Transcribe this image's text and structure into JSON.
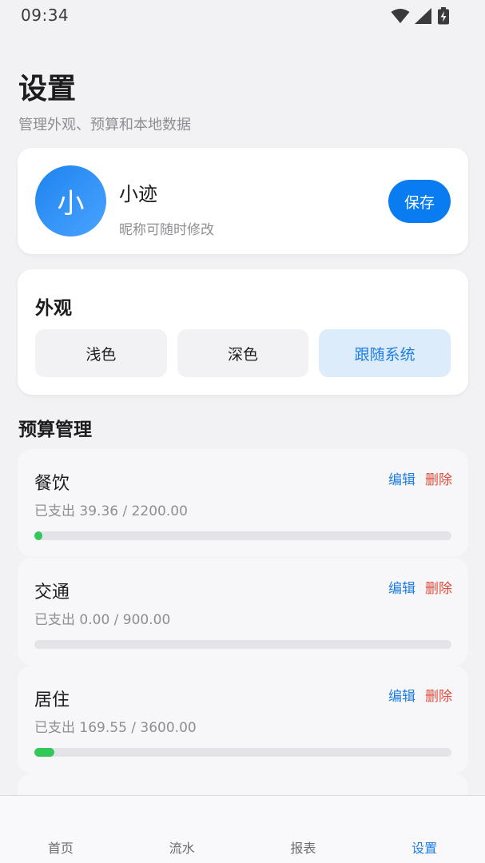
{
  "status_bar": {
    "time": "09:34",
    "icons": [
      "wifi-icon",
      "signal-icon",
      "battery-charging-icon"
    ]
  },
  "header": {
    "title": "设置",
    "subtitle": "管理外观、预算和本地数据"
  },
  "profile": {
    "avatar_text": "小",
    "nickname": "小迹",
    "hint": "昵称可随时修改",
    "save_label": "保存"
  },
  "appearance": {
    "title": "外观",
    "options": [
      {
        "label": "浅色",
        "selected": false
      },
      {
        "label": "深色",
        "selected": false
      },
      {
        "label": "跟随系统",
        "selected": true
      }
    ]
  },
  "budget": {
    "title": "预算管理",
    "edit_label": "编辑",
    "delete_label": "删除",
    "items": [
      {
        "name": "餐饮",
        "spent_text": "已支出 39.36 / 2200.00",
        "progress": 0.018
      },
      {
        "name": "交通",
        "spent_text": "已支出 0.00 / 900.00",
        "progress": 0
      },
      {
        "name": "居住",
        "spent_text": "已支出 169.55 / 3600.00",
        "progress": 0.047
      }
    ]
  },
  "nav": {
    "items": [
      {
        "label": "首页",
        "active": false
      },
      {
        "label": "流水",
        "active": false
      },
      {
        "label": "报表",
        "active": false
      },
      {
        "label": "设置",
        "active": true
      }
    ]
  },
  "colors": {
    "accent": "#0a7cf2",
    "progress": "#34c759",
    "delete": "#e44b3b"
  }
}
